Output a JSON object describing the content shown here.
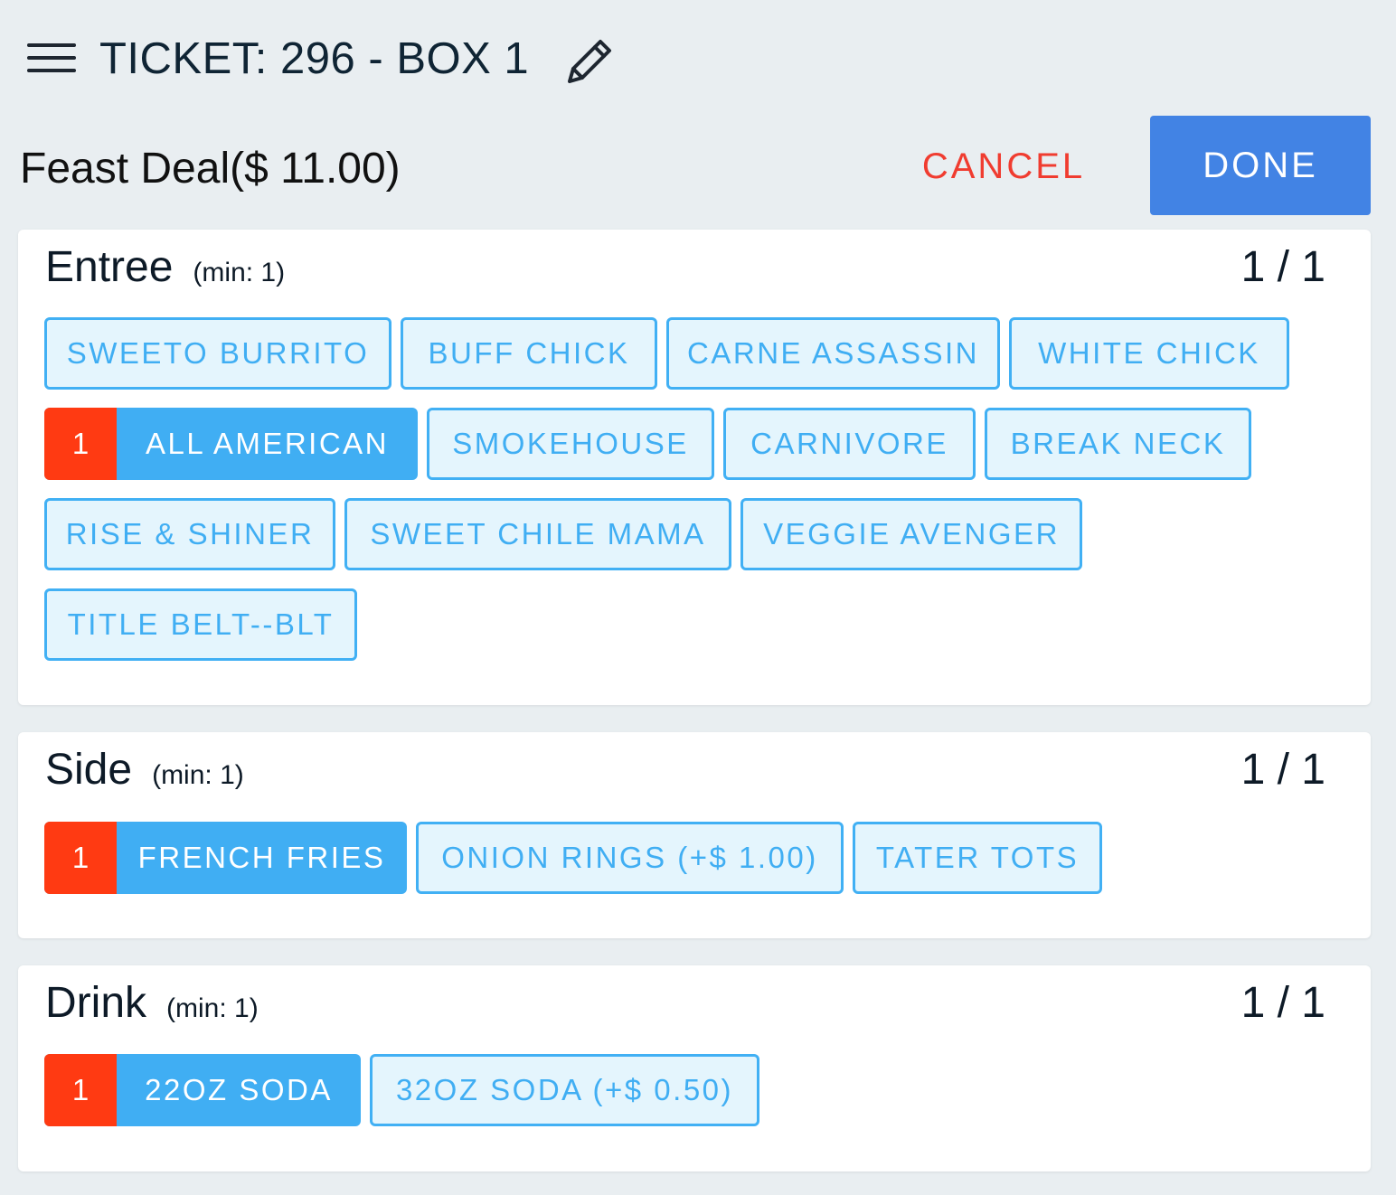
{
  "header": {
    "ticket_title": "TICKET: 296 - BOX 1",
    "menu_icon": "hamburger-menu-icon",
    "edit_icon": "pencil-icon"
  },
  "deal": {
    "title": "Feast Deal($ 11.00)",
    "cancel_label": "CANCEL",
    "done_label": "DONE"
  },
  "colors": {
    "accent": "#40aef3",
    "done": "#4283e4",
    "cancel": "#f03c30",
    "quantity_badge": "#ff3a12"
  },
  "sections": [
    {
      "name": "Entree",
      "min": "(min: 1)",
      "count": "1 / 1",
      "options": [
        {
          "label": "SWEETO BURRITO",
          "selected": false
        },
        {
          "label": "BUFF CHICK",
          "selected": false
        },
        {
          "label": "CARNE ASSASSIN",
          "selected": false
        },
        {
          "label": "WHITE CHICK",
          "selected": false
        },
        {
          "label": "ALL AMERICAN",
          "selected": true,
          "qty": "1"
        },
        {
          "label": "SMOKEHOUSE",
          "selected": false
        },
        {
          "label": "CARNIVORE",
          "selected": false
        },
        {
          "label": "BREAK NECK",
          "selected": false
        },
        {
          "label": "RISE & SHINER",
          "selected": false
        },
        {
          "label": "SWEET CHILE MAMA",
          "selected": false
        },
        {
          "label": "VEGGIE AVENGER",
          "selected": false
        },
        {
          "label": "TITLE BELT--BLT",
          "selected": false
        }
      ]
    },
    {
      "name": "Side",
      "min": "(min: 1)",
      "count": "1 / 1",
      "options": [
        {
          "label": "FRENCH FRIES",
          "selected": true,
          "qty": "1"
        },
        {
          "label": "ONION RINGS (+$ 1.00)",
          "selected": false
        },
        {
          "label": "TATER TOTS",
          "selected": false
        }
      ]
    },
    {
      "name": "Drink",
      "min": "(min: 1)",
      "count": "1 / 1",
      "options": [
        {
          "label": "22OZ SODA",
          "selected": true,
          "qty": "1"
        },
        {
          "label": "32OZ SODA (+$ 0.50)",
          "selected": false
        }
      ]
    }
  ]
}
